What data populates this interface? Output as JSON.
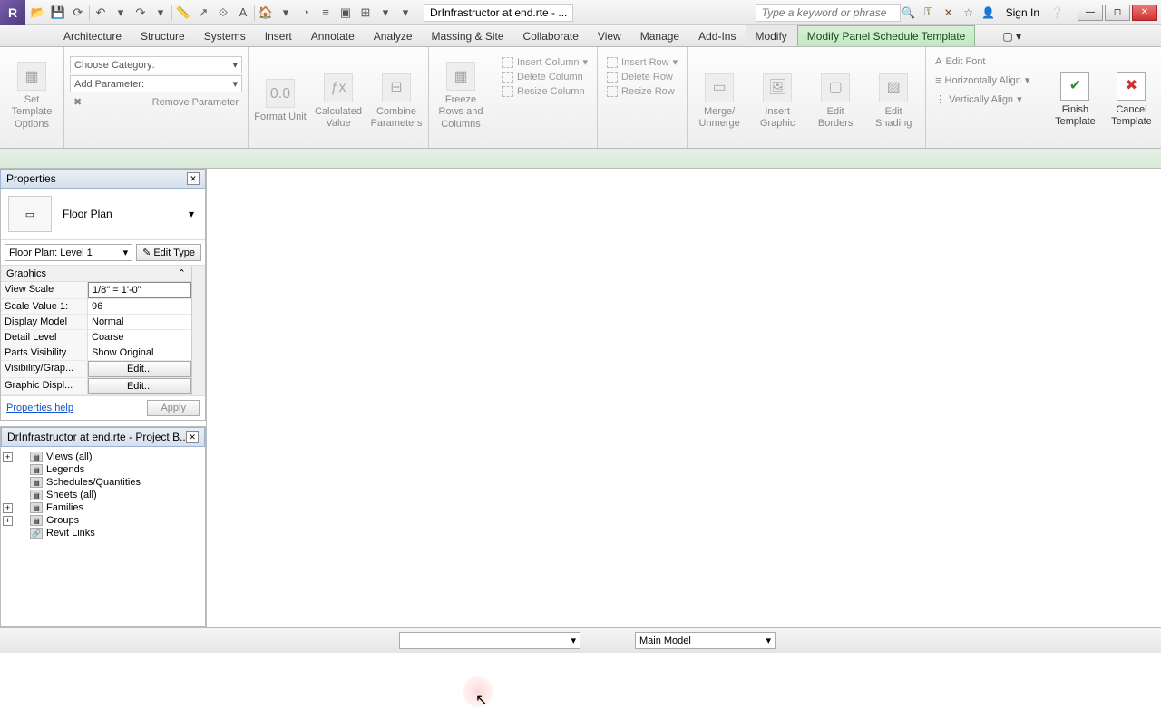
{
  "titlebar": {
    "doc_title": "DrInfrastructor at end.rte - ...",
    "search_placeholder": "Type a keyword or phrase",
    "signin": "Sign In"
  },
  "tabs": [
    "Architecture",
    "Structure",
    "Systems",
    "Insert",
    "Annotate",
    "Analyze",
    "Massing & Site",
    "Collaborate",
    "View",
    "Manage",
    "Add-Ins",
    "Modify",
    "Modify Panel Schedule Template"
  ],
  "ribbon": {
    "set_tpl": "Set Template Options",
    "choose_cat": "Choose Category:",
    "add_param": "Add Parameter:",
    "remove_param": "Remove Parameter",
    "format_unit": "Format Unit",
    "calc_value": "Calculated Value",
    "combine_params": "Combine Parameters",
    "freeze": "Freeze Rows and Columns",
    "ins_col": "Insert  Column",
    "del_col": "Delete  Column",
    "res_col": "Resize  Column",
    "ins_row": "Insert  Row",
    "del_row": "Delete  Row",
    "res_row": "Resize  Row",
    "merge": "Merge/ Unmerge",
    "ins_graphic": "Insert Graphic",
    "edit_borders": "Edit Borders",
    "edit_shading": "Edit Shading",
    "edit_font": "Edit  Font",
    "h_align": "Horizontally  Align",
    "v_align": "Vertically  Align",
    "finish": "Finish Template",
    "cancel": "Cancel Template"
  },
  "props": {
    "title": "Properties",
    "type": "Floor Plan",
    "instance": "Floor Plan: Level 1",
    "edit_type": "Edit Type",
    "group": "Graphics",
    "rows": [
      {
        "k": "View Scale",
        "v": "1/8\" = 1'-0\"",
        "sel": true
      },
      {
        "k": "Scale Value    1:",
        "v": "96"
      },
      {
        "k": "Display Model",
        "v": "Normal"
      },
      {
        "k": "Detail Level",
        "v": "Coarse"
      },
      {
        "k": "Parts Visibility",
        "v": "Show Original"
      },
      {
        "k": "Visibility/Grap...",
        "v": "Edit...",
        "btn": true
      },
      {
        "k": "Graphic Displ...",
        "v": "Edit...",
        "btn": true
      }
    ],
    "help": "Properties help",
    "apply": "Apply"
  },
  "browser": {
    "title": "DrInfrastructor at end.rte - Project B...",
    "nodes": [
      {
        "label": "Views (all)",
        "exp": true
      },
      {
        "label": "Legends",
        "exp": false,
        "leaf": true
      },
      {
        "label": "Schedules/Quantities",
        "exp": false,
        "leaf": true
      },
      {
        "label": "Sheets (all)",
        "exp": false,
        "leaf": true
      },
      {
        "label": "Families",
        "exp": true
      },
      {
        "label": "Groups",
        "exp": true
      },
      {
        "label": "Revit Links",
        "exp": false,
        "leaf": true,
        "link": true
      }
    ]
  },
  "status": {
    "design_option": "Main Model"
  }
}
